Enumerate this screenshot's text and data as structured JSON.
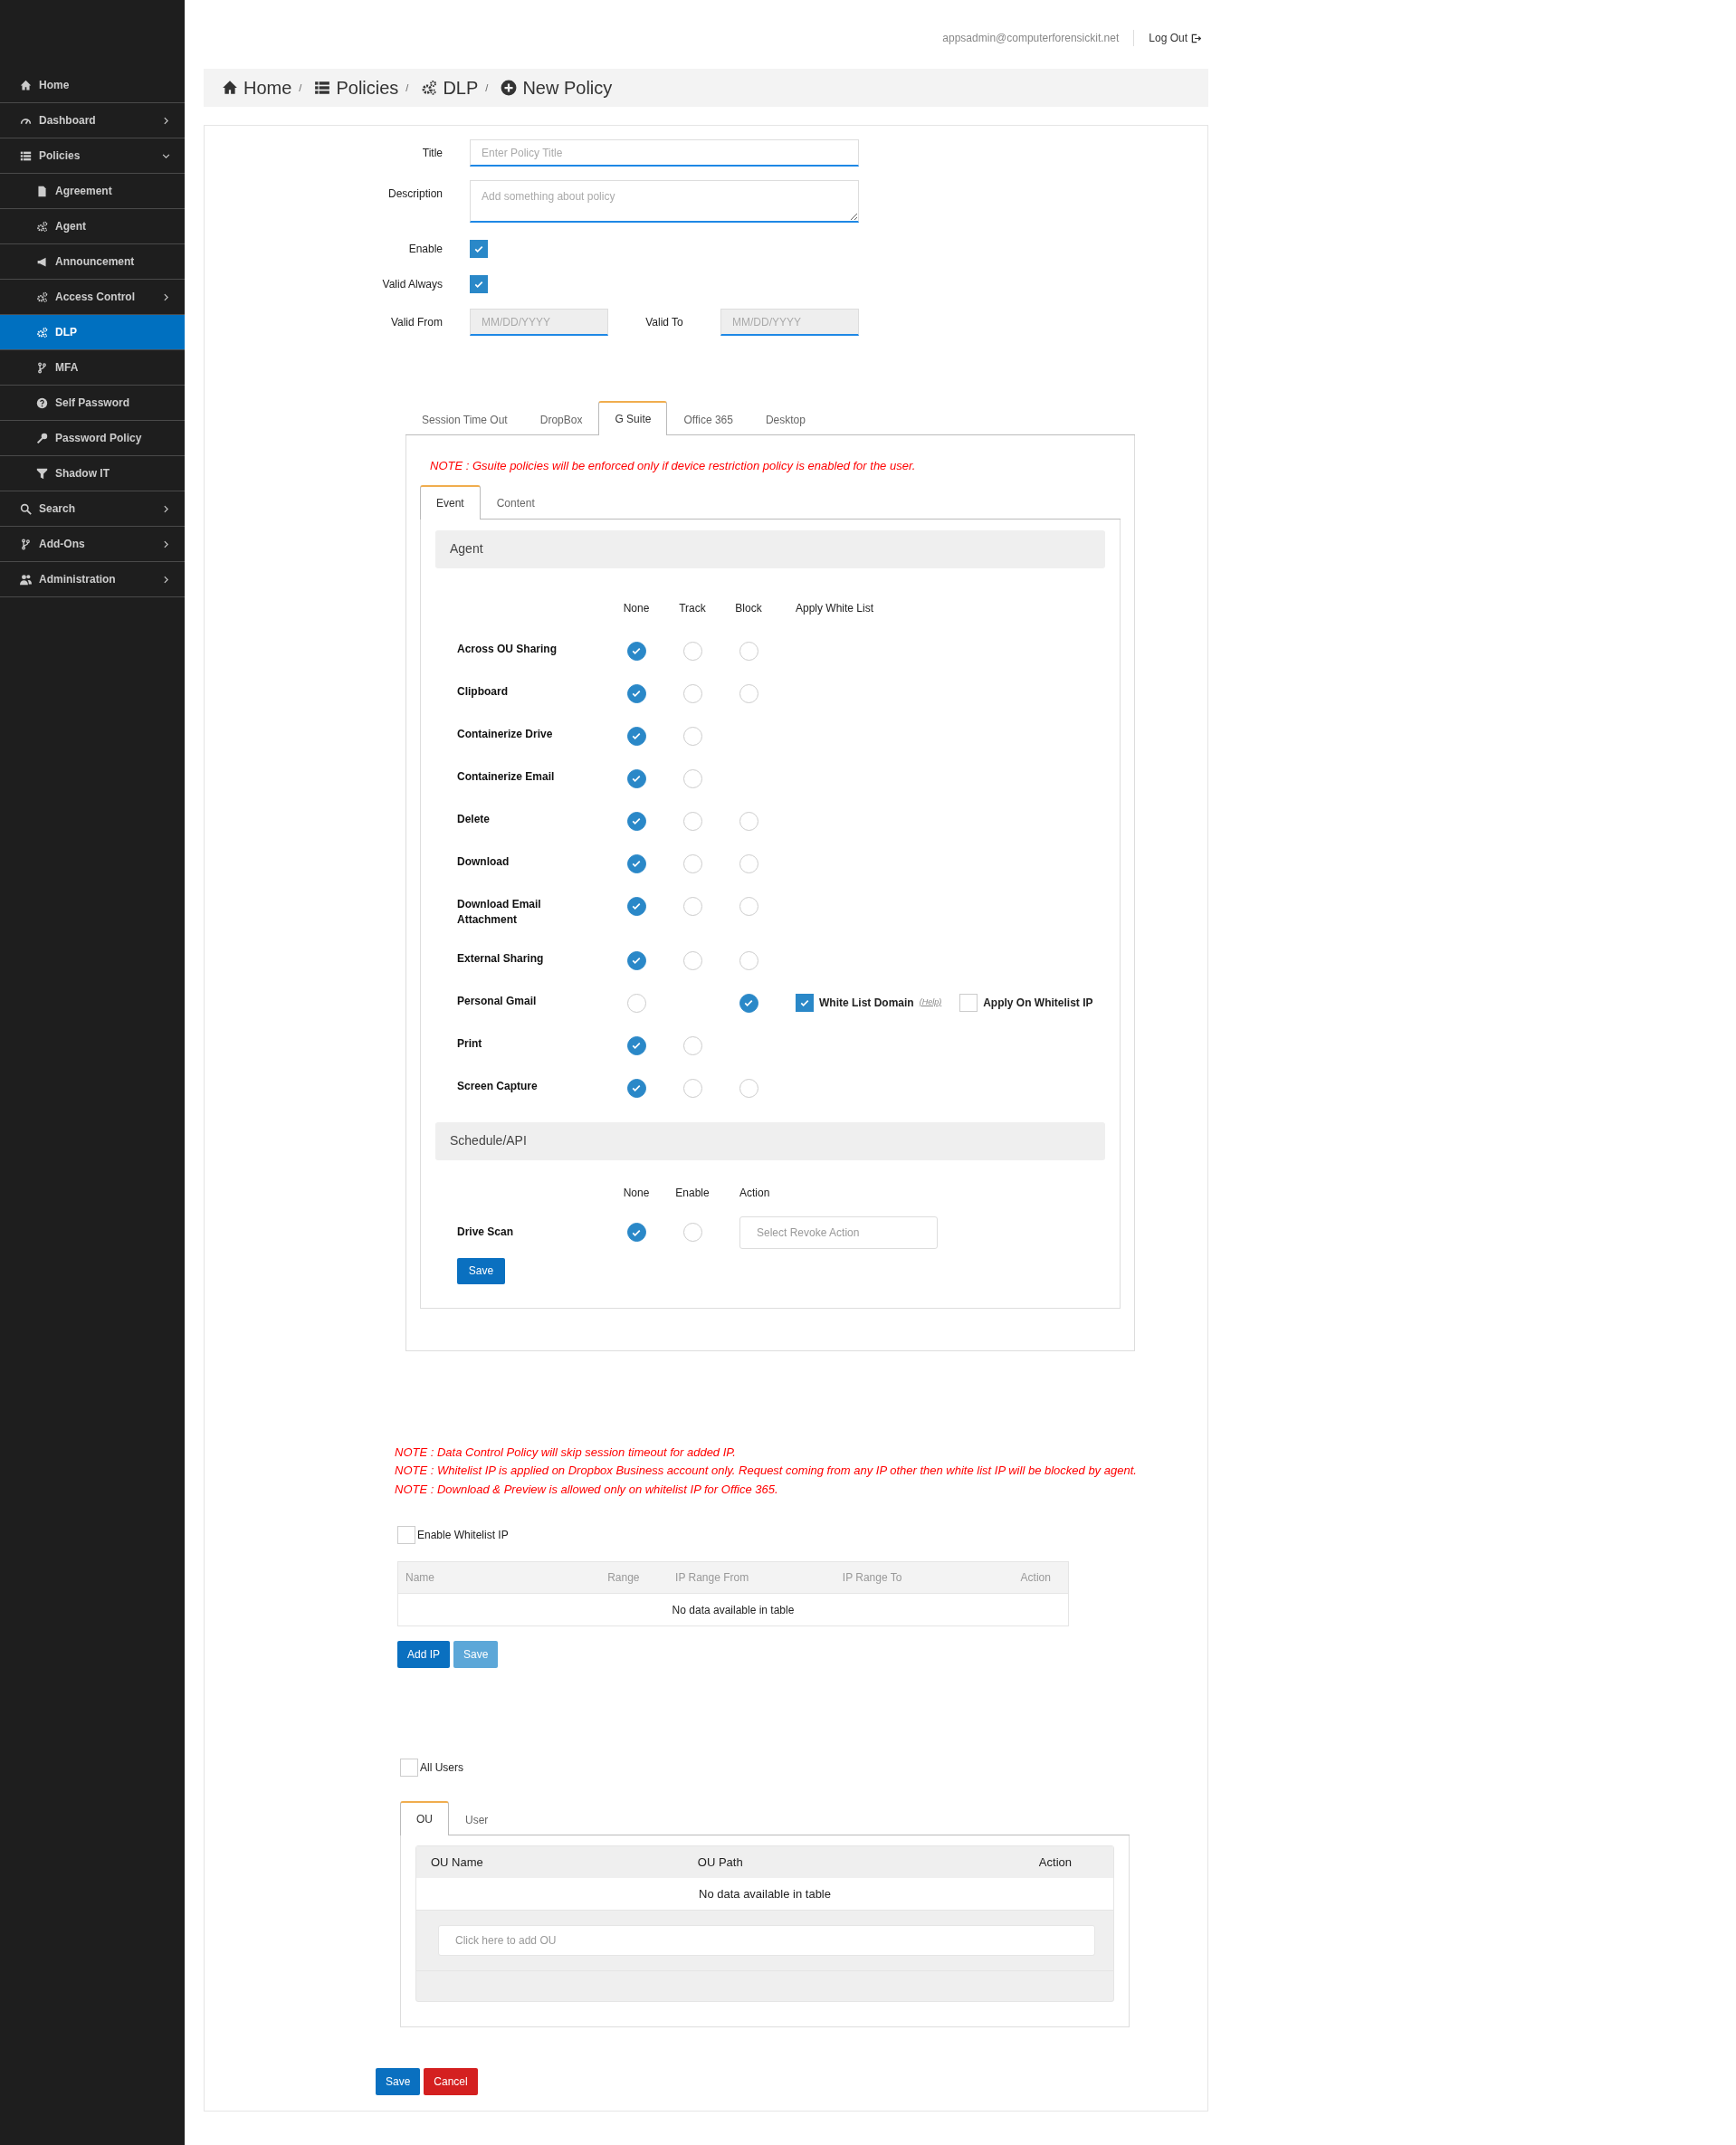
{
  "header": {
    "user_email": "appsadmin@computerforensickit.net",
    "logout": "Log Out"
  },
  "sidebar": {
    "items": [
      {
        "label": "Home",
        "selected": false
      },
      {
        "label": "Dashboard",
        "selected": false,
        "expanded": false
      },
      {
        "label": "Policies",
        "selected": false,
        "expanded": true,
        "children": [
          {
            "label": "Agreement",
            "selected": false
          },
          {
            "label": "Agent",
            "selected": false
          },
          {
            "label": "Announcement",
            "selected": false
          },
          {
            "label": "Access Control",
            "selected": false,
            "expanded": false
          },
          {
            "label": "DLP",
            "selected": true
          },
          {
            "label": "MFA",
            "selected": false
          },
          {
            "label": "Self Password",
            "selected": false
          },
          {
            "label": "Password Policy",
            "selected": false
          },
          {
            "label": "Shadow IT",
            "selected": false
          }
        ]
      },
      {
        "label": "Search",
        "selected": false,
        "expanded": false
      },
      {
        "label": "Add-Ons",
        "selected": false,
        "expanded": false
      },
      {
        "label": "Administration",
        "selected": false,
        "expanded": false
      }
    ]
  },
  "breadcrumb": {
    "separator": "/",
    "items": [
      {
        "label": "Home"
      },
      {
        "label": "Policies"
      },
      {
        "label": "DLP"
      },
      {
        "label": "New Policy"
      }
    ]
  },
  "form": {
    "title": {
      "label": "Title",
      "placeholder": "Enter Policy Title"
    },
    "description": {
      "label": "Description",
      "placeholder": "Add something about policy"
    },
    "enable": {
      "label": "Enable",
      "checked": true
    },
    "valid_always": {
      "label": "Valid Always",
      "checked": true
    },
    "valid_from": {
      "label": "Valid From",
      "placeholder": "MM/DD/YYYY",
      "disabled": true
    },
    "valid_to": {
      "label": "Valid To",
      "placeholder": "MM/DD/YYYY",
      "disabled": true
    }
  },
  "policy_tabs": [
    {
      "label": "Session Time Out",
      "selected": false
    },
    {
      "label": "DropBox",
      "selected": false
    },
    {
      "label": "G Suite",
      "selected": true
    },
    {
      "label": "Office 365",
      "selected": false
    },
    {
      "label": "Desktop",
      "selected": false
    }
  ],
  "gsuite": {
    "note": "NOTE : Gsuite policies will be enforced only if device restriction policy is enabled for the user.",
    "sub_tabs": [
      {
        "label": "Event",
        "selected": true
      },
      {
        "label": "Content",
        "selected": false
      }
    ],
    "agent": {
      "title": "Agent",
      "columns": [
        "None",
        "Track",
        "Block",
        "Apply White List"
      ],
      "rows": [
        {
          "label": "Across OU Sharing",
          "none": {
            "selected": true
          },
          "track": {
            "selected": false
          },
          "block": {
            "selected": false
          }
        },
        {
          "label": "Clipboard",
          "none": {
            "selected": true
          },
          "track": {
            "selected": false
          },
          "block": {
            "selected": false
          }
        },
        {
          "label": "Containerize Drive",
          "none": {
            "selected": true
          },
          "track": {
            "selected": false
          }
        },
        {
          "label": "Containerize Email",
          "none": {
            "selected": true
          },
          "track": {
            "selected": false
          }
        },
        {
          "label": "Delete",
          "none": {
            "selected": true
          },
          "track": {
            "selected": false
          },
          "block": {
            "selected": false
          }
        },
        {
          "label": "Download",
          "none": {
            "selected": true
          },
          "track": {
            "selected": false
          },
          "block": {
            "selected": false
          }
        },
        {
          "label": "Download Email Attachment",
          "none": {
            "selected": true
          },
          "track": {
            "selected": false
          },
          "block": {
            "selected": false
          }
        },
        {
          "label": "External Sharing",
          "none": {
            "selected": true
          },
          "track": {
            "selected": false
          },
          "block": {
            "selected": false
          }
        },
        {
          "label": "Personal Gmail",
          "none": {
            "selected": false
          },
          "block": {
            "selected": true
          },
          "white_list_domain": {
            "label": "White List Domain",
            "help": "(Help)",
            "checked": true
          },
          "apply_on_whitelist_ip": {
            "label": "Apply On Whitelist IP",
            "checked": false
          }
        },
        {
          "label": "Print",
          "none": {
            "selected": true
          },
          "track": {
            "selected": false
          }
        },
        {
          "label": "Screen Capture",
          "none": {
            "selected": true
          },
          "track": {
            "selected": false
          },
          "block": {
            "selected": false
          }
        }
      ]
    },
    "schedule": {
      "title": "Schedule/API",
      "columns": [
        "None",
        "Enable",
        "Action"
      ],
      "rows": [
        {
          "label": "Drive Scan",
          "none": {
            "selected": true
          },
          "enable": {
            "selected": false
          },
          "action": {
            "placeholder": "Select Revoke Action"
          }
        }
      ],
      "save_button": "Save"
    }
  },
  "whitelist": {
    "notes": [
      "NOTE : Data Control Policy will skip session timeout for added IP.",
      "NOTE : Whitelist IP is applied on Dropbox Business account only. Request coming from any IP other then white list IP will be blocked by agent.",
      "NOTE : Download & Preview is allowed only on whitelist IP for Office 365."
    ],
    "enable_whitelist": {
      "label": "Enable Whitelist IP",
      "checked": false
    },
    "table": {
      "columns": [
        "Name",
        "Range",
        "IP Range From",
        "IP Range To",
        "Action"
      ],
      "empty_text": "No data available in table"
    },
    "buttons": [
      {
        "label": "Add IP",
        "disabled": false
      },
      {
        "label": "Save",
        "disabled": true
      }
    ]
  },
  "users": {
    "all_users": {
      "label": "All Users",
      "checked": false
    },
    "tabs": [
      {
        "label": "OU",
        "selected": true
      },
      {
        "label": "User",
        "selected": false
      }
    ],
    "table": {
      "columns": [
        "OU Name",
        "OU Path",
        "Action"
      ],
      "empty_text": "No data available in table",
      "add_placeholder": "Click here to add OU"
    }
  },
  "footer_buttons": [
    {
      "label": "Save",
      "kind": "primary"
    },
    {
      "label": "Cancel",
      "kind": "danger"
    }
  ]
}
